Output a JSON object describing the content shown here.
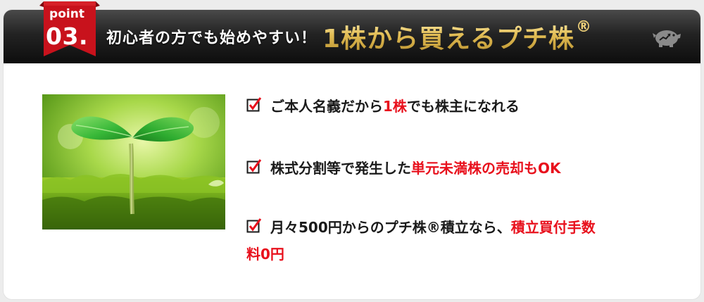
{
  "badge": {
    "label": "point",
    "number": "03."
  },
  "header": {
    "lead": "初心者の方でも始めやすい！",
    "highlight": "1株から買えるプチ株",
    "registered": "®"
  },
  "benefits": [
    {
      "pre": "ご本人名義だから",
      "highlight": "1株",
      "post": "でも株主になれる"
    },
    {
      "pre": "株式分割等で発生した",
      "highlight": "単元未満株の売却もOK",
      "post": ""
    },
    {
      "pre": "月々500円からのプチ株®積立なら、",
      "highlight_1": "積立買付手数",
      "highlight_2": "料0円"
    }
  ],
  "icons": {
    "badge": "ribbon-badge-icon",
    "piggy": "piggy-bank-icon",
    "check": "checkbox-check-icon"
  },
  "colors": {
    "accent_red": "#e8101c",
    "header_dark": "#111111",
    "gold": "#e2bd55",
    "badge_red": "#c8121c"
  }
}
